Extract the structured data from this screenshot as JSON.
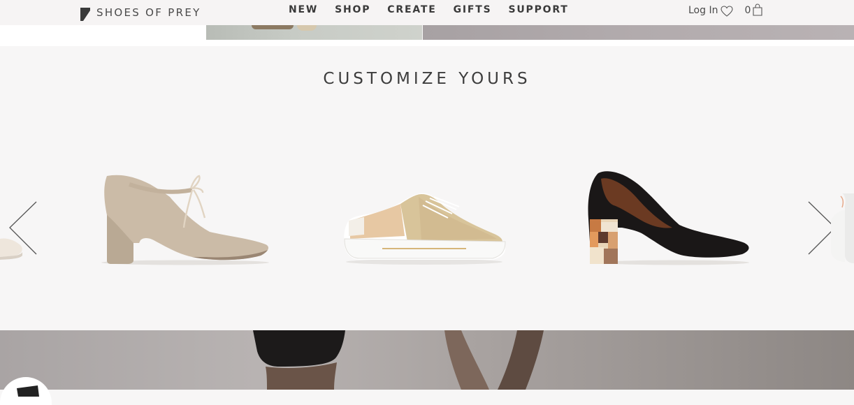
{
  "header": {
    "brand": "SHOES OF PREY",
    "nav": [
      "NEW",
      "SHOP",
      "CREATE",
      "GIFTS",
      "SUPPORT"
    ],
    "login": "Log In",
    "cart_count": "0"
  },
  "customize": {
    "title": "CUSTOMIZE YOURS",
    "products": [
      "suede-ankle-tie-block-heel-pump",
      "metallic-leather-sneaker",
      "black-suede-pump-patterned-heel"
    ]
  },
  "colors": {
    "header_bg": "#f6f4f4",
    "section_bg": "#f7f6f6",
    "text": "#3d3d3d"
  }
}
